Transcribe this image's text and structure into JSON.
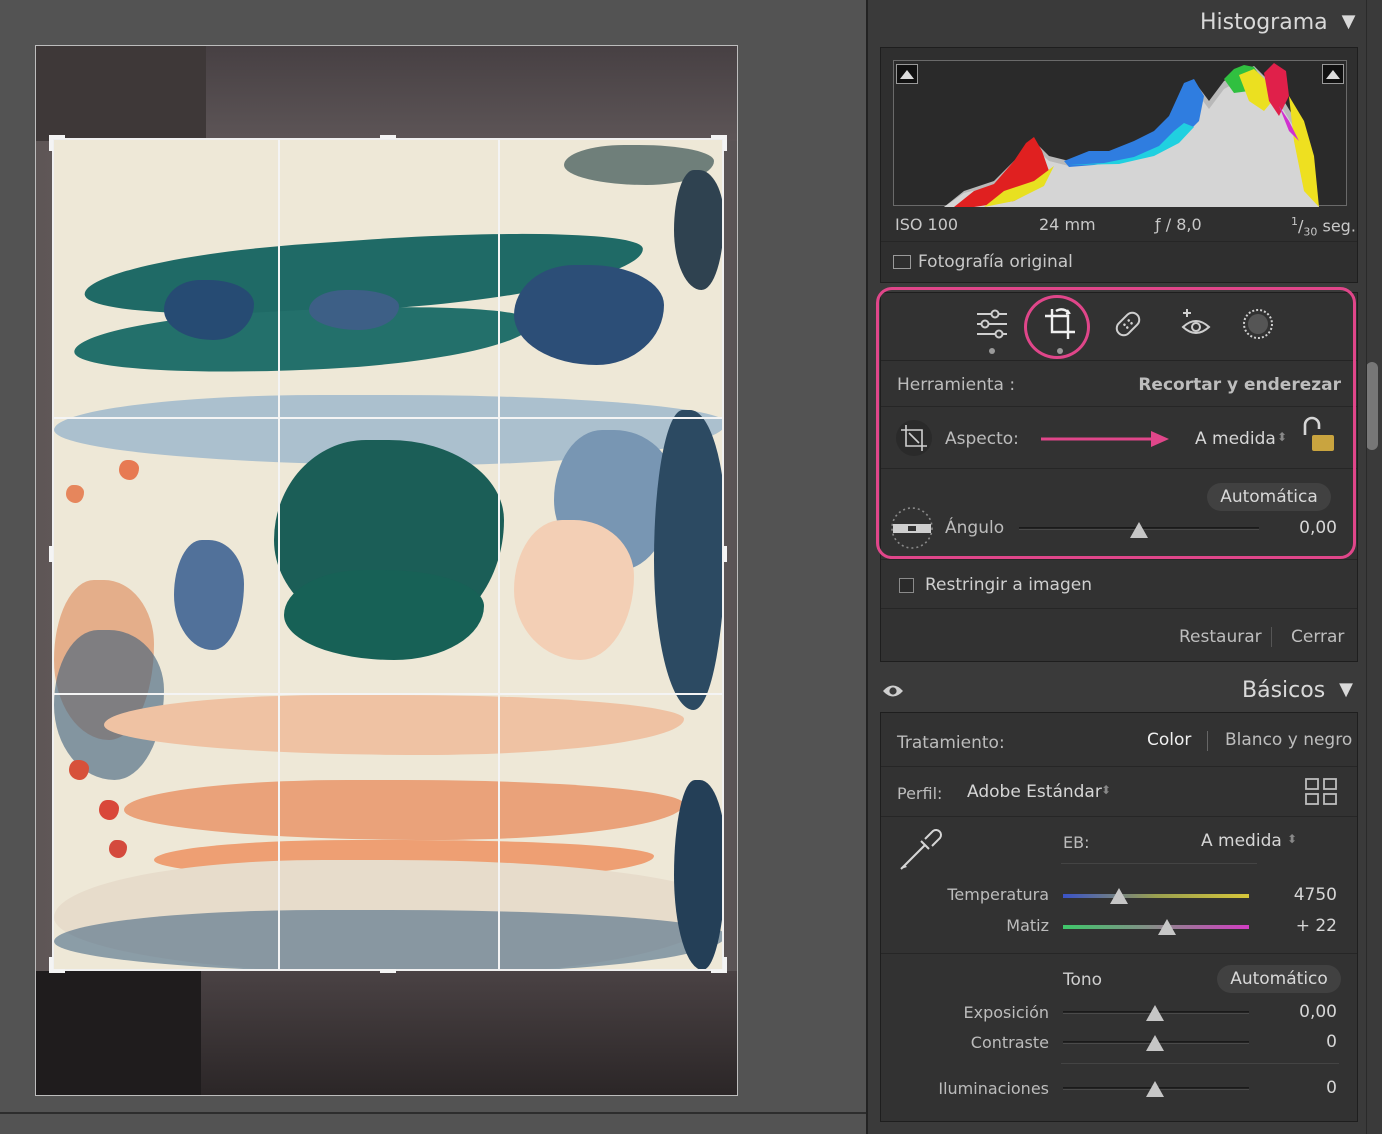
{
  "histogram": {
    "title": "Histograma",
    "iso": "ISO 100",
    "focal": "24 mm",
    "aperture": "ƒ / 8,0",
    "shutter_num": "1",
    "shutter_den": "30",
    "shutter_unit": "seg.",
    "original_label": "Fotografía original"
  },
  "crop": {
    "tool_label": "Herramienta :",
    "tool_value": "Recortar y enderezar",
    "aspect_label": "Aspecto:",
    "aspect_value": "A medida",
    "auto_label": "Automática",
    "angle_label": "Ángulo",
    "angle_value": "0,00",
    "angle_level": 0.5,
    "constrain_label": "Restringir a imagen",
    "reset_label": "Restaurar",
    "close_label": "Cerrar"
  },
  "basics": {
    "title": "Básicos",
    "treatment_label": "Tratamiento:",
    "treatment_color": "Color",
    "treatment_bw": "Blanco y negro",
    "profile_label": "Perfil:",
    "profile_value": "Adobe Estándar",
    "wb_label": "EB:",
    "wb_value": "A medida",
    "temp_label": "Temperatura",
    "temp_value": "4750",
    "temp_level": 0.3,
    "tint_label": "Matiz",
    "tint_value": "+ 22",
    "tint_level": 0.56,
    "tone_label": "Tono",
    "tone_auto": "Automático",
    "exposure_label": "Exposición",
    "exposure_value": "0,00",
    "contrast_label": "Contraste",
    "contrast_value": "0",
    "highlights_label": "Iluminaciones",
    "highlights_value": "0"
  },
  "colors": {
    "accent": "#e0468a"
  }
}
